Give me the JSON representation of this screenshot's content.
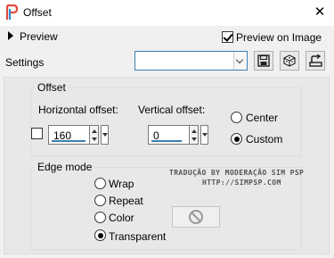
{
  "window": {
    "title": "Offset",
    "close_glyph": "✕",
    "app_icon": "psp-app-icon"
  },
  "preview": {
    "label": "Preview",
    "preview_on_image_label": "Preview on Image",
    "preview_on_image_checked": true
  },
  "settings": {
    "label": "Settings",
    "combo_value": "",
    "buttons": [
      "save-preset-icon",
      "randomize-icon",
      "reset-icon"
    ]
  },
  "offset": {
    "group_title": "Offset",
    "horizontal_label": "Horizontal offset:",
    "horizontal_value": "160",
    "vertical_label": "Vertical offset:",
    "vertical_value": "0",
    "link_checked": false,
    "center_label": "Center",
    "custom_label": "Custom",
    "selected_mode": "Custom"
  },
  "edge_mode": {
    "group_title": "Edge mode",
    "options": [
      "Wrap",
      "Repeat",
      "Color",
      "Transparent"
    ],
    "selected": "Transparent"
  },
  "watermark": {
    "line1": "TRADUÇÃO BY MODERAÇÃO SIM PSP",
    "line2": "HTTP://SIMPSP.COM"
  },
  "colors": {
    "accent": "#3c7fb1",
    "icon_blue": "#2e8fd8",
    "icon_red": "#e04a3c"
  }
}
